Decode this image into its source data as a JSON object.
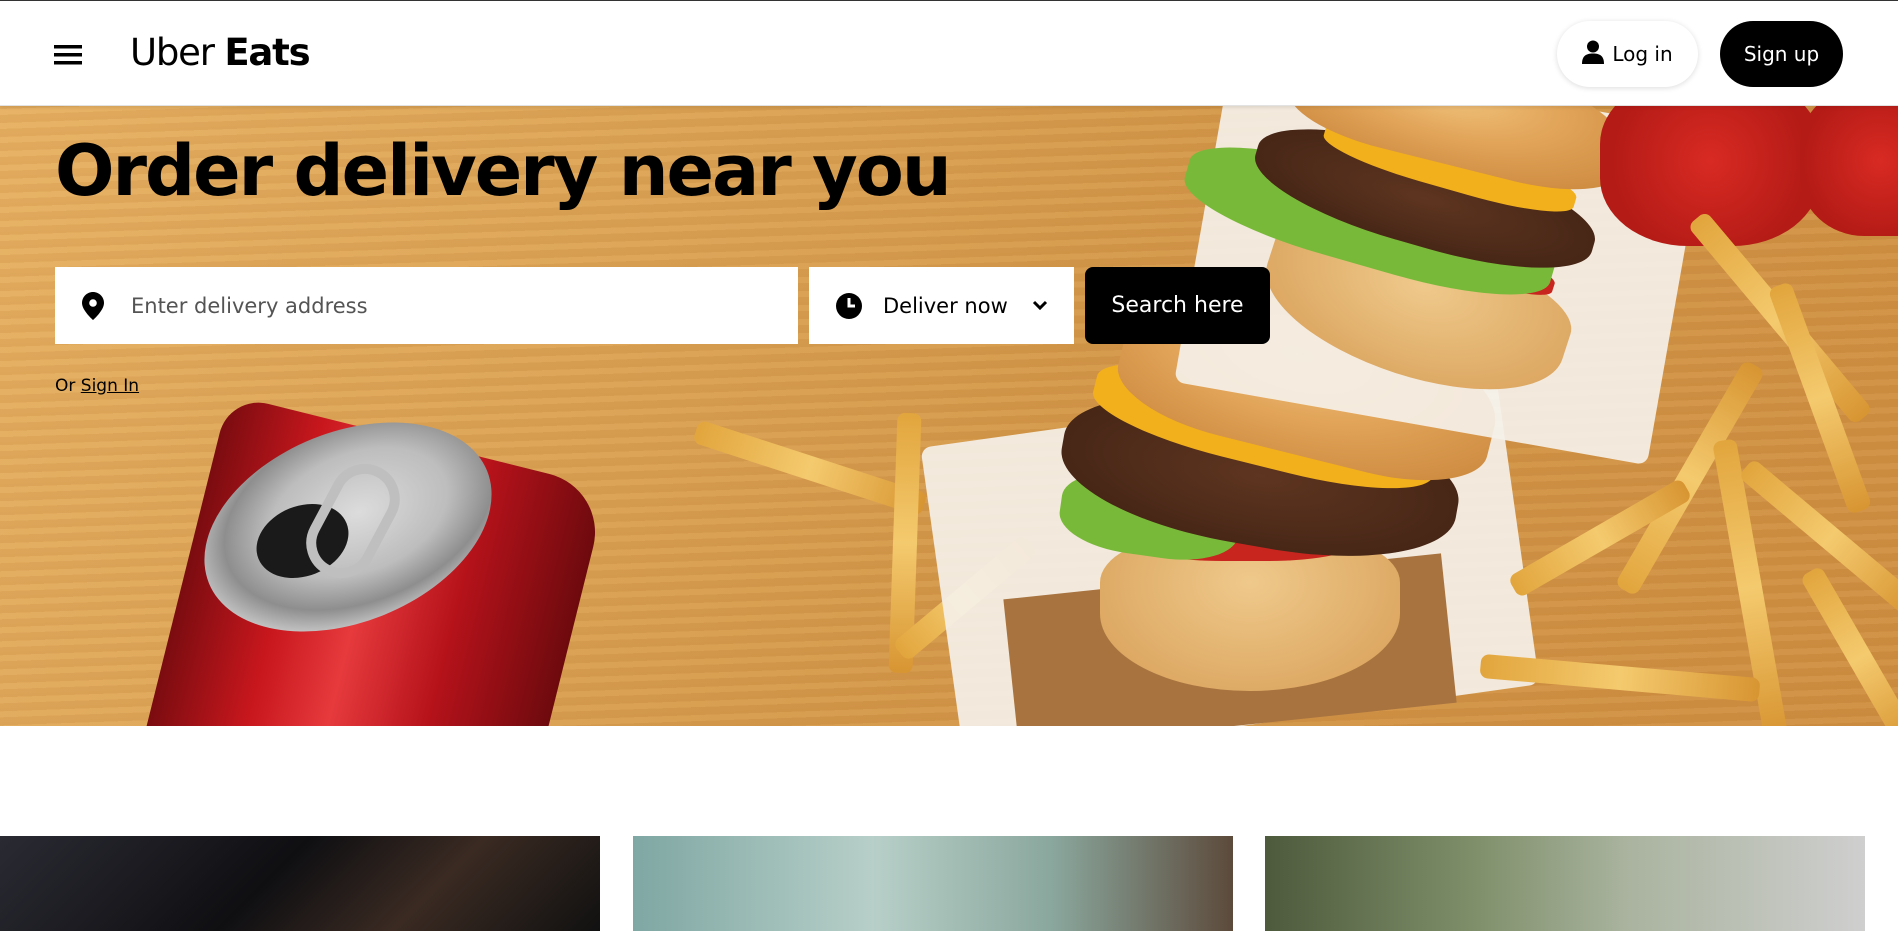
{
  "header": {
    "menu_icon": "hamburger-menu-icon",
    "logo_light": "Uber",
    "logo_bold": "Eats",
    "login_label": "Log in",
    "login_icon": "person-icon",
    "signup_label": "Sign up"
  },
  "hero": {
    "title": "Order delivery near you",
    "address": {
      "placeholder": "Enter delivery address",
      "value": "",
      "icon": "location-pin-icon"
    },
    "delivery_time": {
      "label": "Deliver now",
      "icon": "clock-icon",
      "dropdown_icon": "chevron-down-icon"
    },
    "search_label": "Search here",
    "or_text": "Or",
    "signin_link": "Sign In"
  },
  "colors": {
    "primary": "#000000",
    "background": "#ffffff",
    "hero_wood": "#d89c4e"
  }
}
